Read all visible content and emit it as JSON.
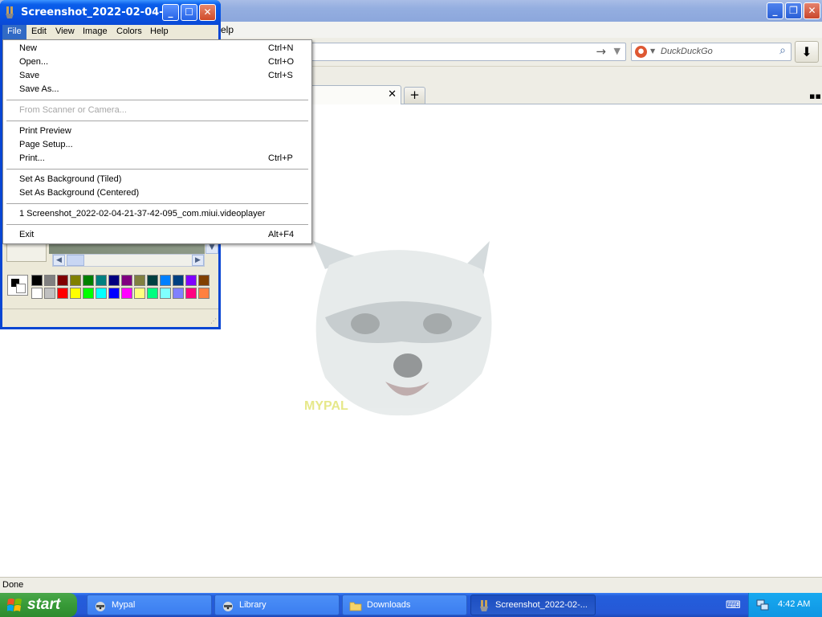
{
  "browser": {
    "menubar_leftover": "elp",
    "search": {
      "placeholder": "DuckDuckGo"
    },
    "status_text": "Done",
    "watermark_text": "MYPAL"
  },
  "paint": {
    "title": "Screenshot_2022-02-04-...",
    "menus": [
      "File",
      "Edit",
      "View",
      "Image",
      "Colors",
      "Help"
    ],
    "palette_top": [
      "#000000",
      "#808080",
      "#800000",
      "#808000",
      "#008000",
      "#008080",
      "#000080",
      "#800080",
      "#808040",
      "#004040",
      "#0080ff",
      "#004080",
      "#8000ff",
      "#804000"
    ],
    "palette_bottom": [
      "#ffffff",
      "#c0c0c0",
      "#ff0000",
      "#ffff00",
      "#00ff00",
      "#00ffff",
      "#0000ff",
      "#ff00ff",
      "#ffff80",
      "#00ff80",
      "#80ffff",
      "#8080ff",
      "#ff0080",
      "#ff8040"
    ]
  },
  "file_menu": {
    "items": [
      {
        "label": "New",
        "shortcut": "Ctrl+N"
      },
      {
        "label": "Open...",
        "shortcut": "Ctrl+O"
      },
      {
        "label": "Save",
        "shortcut": "Ctrl+S"
      },
      {
        "label": "Save As...",
        "shortcut": ""
      },
      {
        "label": "From Scanner or Camera...",
        "shortcut": "",
        "disabled": true
      },
      {
        "label": "Print Preview",
        "shortcut": ""
      },
      {
        "label": "Page Setup...",
        "shortcut": ""
      },
      {
        "label": "Print...",
        "shortcut": "Ctrl+P"
      },
      {
        "label": "Set As Background (Tiled)",
        "shortcut": ""
      },
      {
        "label": "Set As Background (Centered)",
        "shortcut": ""
      },
      {
        "label": "1 Screenshot_2022-02-04-21-37-42-095_com.miui.videoplayer",
        "shortcut": ""
      },
      {
        "label": "Exit",
        "shortcut": "Alt+F4"
      }
    ]
  },
  "taskbar": {
    "start_label": "start",
    "buttons": [
      {
        "label": "Mypal",
        "icon": "raccoon-icon"
      },
      {
        "label": "Library",
        "icon": "raccoon-icon"
      },
      {
        "label": "Downloads",
        "icon": "folder-icon"
      },
      {
        "label": "Screenshot_2022-02-...",
        "icon": "paint-icon",
        "active": true
      }
    ],
    "clock": "4:42 AM"
  }
}
